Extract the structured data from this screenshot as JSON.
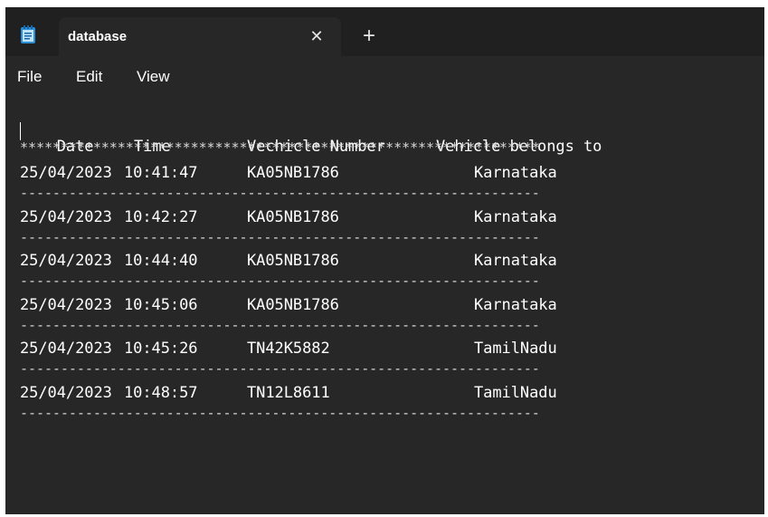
{
  "tab": {
    "title": "database",
    "close_glyph": "✕",
    "new_tab_glyph": "+",
    "icon": "notepad-icon"
  },
  "menu": {
    "items": [
      "File",
      "Edit",
      "View"
    ]
  },
  "document": {
    "header": {
      "date": "Date",
      "time": "Time",
      "vehicle_number": "Vechicle Number",
      "belongs_to": "Vehicle belongs to"
    },
    "header_rule": "****************************************************************",
    "rule": "----------------------------------------------------------------",
    "rows": [
      {
        "date": "25/04/2023",
        "time": "10:41:47",
        "vehicle_number": "KA05NB1786",
        "belongs_to": "Karnataka"
      },
      {
        "date": "25/04/2023",
        "time": "10:42:27",
        "vehicle_number": "KA05NB1786",
        "belongs_to": "Karnataka"
      },
      {
        "date": "25/04/2023",
        "time": "10:44:40",
        "vehicle_number": "KA05NB1786",
        "belongs_to": "Karnataka"
      },
      {
        "date": "25/04/2023",
        "time": "10:45:06",
        "vehicle_number": "KA05NB1786",
        "belongs_to": "Karnataka"
      },
      {
        "date": "25/04/2023",
        "time": "10:45:26",
        "vehicle_number": "TN42K5882",
        "belongs_to": "TamilNadu"
      },
      {
        "date": "25/04/2023",
        "time": "10:48:57",
        "vehicle_number": "TN12L8611",
        "belongs_to": "TamilNadu"
      }
    ]
  },
  "colors": {
    "window_bg": "#272727",
    "titlebar_bg": "#202020",
    "text": "#ffffff",
    "icon_accent": "#2a8fd6"
  }
}
